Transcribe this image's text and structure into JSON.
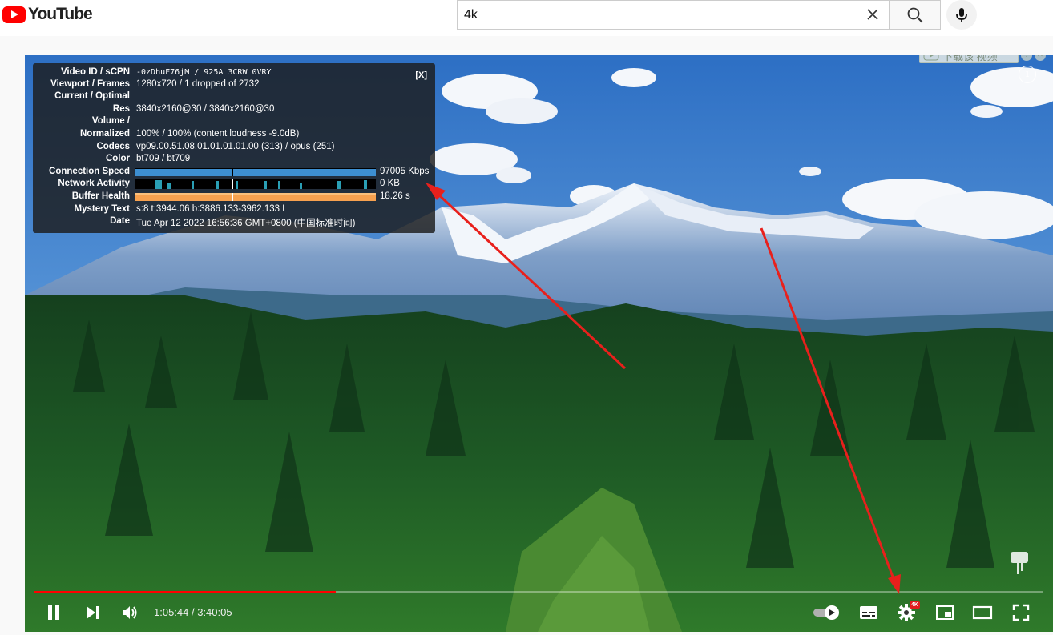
{
  "header": {
    "logo_text": "YouTube",
    "search_value": "4k",
    "clear_icon": "close-icon",
    "search_icon": "search-icon",
    "mic_icon": "mic-icon"
  },
  "stats": {
    "close_label": "[X]",
    "rows": [
      {
        "label": "Video ID / sCPN",
        "value": "-0zDhuF76jM / 925A 3CRW 0VRY"
      },
      {
        "label": "Viewport / Frames",
        "value": "1280x720 / 1 dropped of 2732"
      },
      {
        "label": "Current / Optimal",
        "value": ""
      },
      {
        "label": "Res",
        "value": "3840x2160@30 / 3840x2160@30"
      },
      {
        "label": "Volume /",
        "value": ""
      },
      {
        "label": "Normalized",
        "value": "100% / 100% (content loudness -9.0dB)"
      },
      {
        "label": "Codecs",
        "value": "vp09.00.51.08.01.01.01.01.00 (313) / opus (251)"
      },
      {
        "label": "Color",
        "value": "bt709 / bt709"
      },
      {
        "label": "Connection Speed",
        "value": "97005 Kbps"
      },
      {
        "label": "Network Activity",
        "value": "0 KB"
      },
      {
        "label": "Buffer Health",
        "value": "18.26 s"
      },
      {
        "label": "Mystery Text",
        "value": "s:8 t:3944.06 b:3886.133-3962.133 L"
      },
      {
        "label": "Date",
        "value": "Tue Apr 12 2022 16:56:36 GMT+0800 (中国标准时间)"
      }
    ]
  },
  "download_helper": {
    "label": "下载该 视频",
    "help": "?",
    "close": "✕"
  },
  "controls": {
    "current_time": "1:05:44",
    "duration": "3:40:05",
    "time_display": "1:05:44 / 3:40:05",
    "progress_fraction": 0.2988,
    "quality_badge": "4K"
  },
  "colors": {
    "brand_red": "#ff0000",
    "speed_bar": "#3d8fd1",
    "buffer_bar": "#f7a14f",
    "network_bar": "#2a9fb5"
  }
}
